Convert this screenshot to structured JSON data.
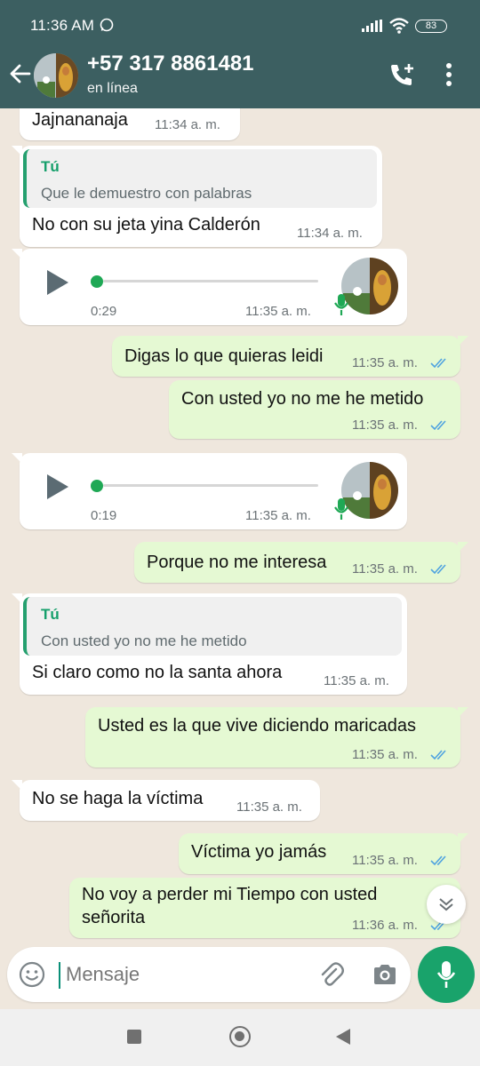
{
  "status_bar": {
    "time": "11:36 AM",
    "battery": "83"
  },
  "header": {
    "contact_name": "+57 317 8861481",
    "contact_status": "en línea"
  },
  "messages": [
    {
      "text": "Jajnananaja",
      "time": "11:34 a. m."
    },
    {
      "quote_author": "Tú",
      "quote_text": "Que le demuestro con palabras",
      "text": "No con su jeta yina Calderón",
      "time": "11:34 a. m."
    },
    {
      "voice_duration": "0:29",
      "time": "11:35 a. m."
    },
    {
      "text": "Digas lo que quieras leidi",
      "time": "11:35 a. m."
    },
    {
      "text": "Con usted yo no me he metido",
      "time": "11:35 a. m."
    },
    {
      "voice_duration": "0:19",
      "time": "11:35 a. m."
    },
    {
      "text": "Porque no me interesa",
      "time": "11:35 a. m."
    },
    {
      "quote_author": "Tú",
      "quote_text": "Con usted yo no me he metido",
      "text": "Si claro como no la santa ahora",
      "time": "11:35 a. m."
    },
    {
      "text": "Usted es la que vive diciendo maricadas",
      "time": "11:35 a. m."
    },
    {
      "text": "No se haga la víctima",
      "time": "11:35 a. m."
    },
    {
      "text": "Víctima yo jamás",
      "time": "11:35 a. m."
    },
    {
      "text_line1": "No voy a perder mi Tiempo con usted",
      "text_line2": "señorita",
      "time": "11:36 a. m."
    }
  ],
  "input": {
    "placeholder": "Mensaje"
  },
  "colors": {
    "header": "#3c5f61",
    "outgoing_bubble": "#e5f9d3",
    "accent": "#19a36b",
    "read_ticks": "#4fa3e0"
  },
  "icons": [
    "back-arrow-icon",
    "add-call-icon",
    "menu-dots-icon",
    "play-icon",
    "mic-icon",
    "emoji-icon",
    "attach-icon",
    "camera-icon",
    "chevron-down-icon"
  ]
}
